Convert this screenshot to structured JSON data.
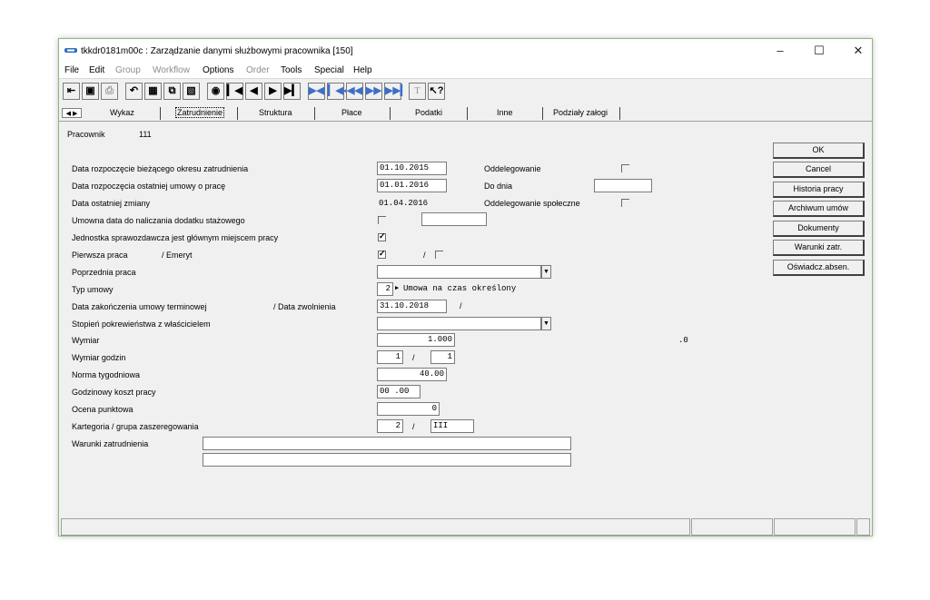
{
  "window": {
    "title": "tkkdr0181m00c : Zarządzanie danymi służbowymi pracownika [150]"
  },
  "menu": [
    {
      "label": "File",
      "enabled": true
    },
    {
      "label": "Edit",
      "enabled": true
    },
    {
      "label": "Group",
      "enabled": false
    },
    {
      "label": "Workflow",
      "enabled": false
    },
    {
      "label": "Options",
      "enabled": true
    },
    {
      "label": "Order",
      "enabled": false
    },
    {
      "label": "Tools",
      "enabled": true
    },
    {
      "label": "Special",
      "enabled": true
    },
    {
      "label": "Help",
      "enabled": true
    }
  ],
  "toolbar": {
    "icons": [
      "exit-icon",
      "save-icon",
      "print-icon",
      "undo-icon",
      "insert-record-icon",
      "copy-record-icon",
      "delete-record-icon",
      "find-icon",
      "first-record-icon",
      "previous-record-icon",
      "next-record-icon",
      "last-record-icon",
      "first-set-icon",
      "previous-set-icon",
      "previous-page-icon",
      "next-page-icon",
      "last-set-icon",
      "text-icon",
      "help-pointer-icon"
    ]
  },
  "tabs": [
    "Wykaz",
    "Zatrudnienie",
    "Struktura",
    "Płace",
    "Podatki",
    "Inne",
    "Podziały załogi"
  ],
  "active_tab": "Zatrudnienie",
  "employee": {
    "label": "Pracownik",
    "value": "111"
  },
  "form": {
    "data_rozpoczecia_okresu_label": "Data rozpoczęcie bieżącego okresu zatrudnienia",
    "data_rozpoczecia_okresu": "01.10.2015",
    "data_rozpoczecia_umowy_label": "Data rozpoczęcia ostatniej umowy o pracę",
    "data_rozpoczecia_umowy": "01.01.2016",
    "data_ostatniej_zmiany_label": "Data ostatniej zmiany",
    "data_ostatniej_zmiany": "01.04.2016",
    "umowna_data_label": "Umowna data do naliczania dodatku stażowego",
    "jednostka_label": "Jednostka sprawozdawcza jest głównym miejscem pracy",
    "pierwsza_praca_label": "Pierwsza praca",
    "emeryt_label": "/    Emeryt",
    "slash": "/",
    "poprzednia_praca_label": "Poprzednia praca",
    "typ_umowy_label": "Typ umowy",
    "typ_umowy_code": "2",
    "typ_umowy_desc": "Umowa na czas określony",
    "data_zakonczenia_label": "Data zakończenia umowy terminowej",
    "data_zwolnienia_label": "/ Data zwolnienia",
    "data_zakonczenia": "31.10.2018",
    "stopien_label": "Stopień pokrewieństwa z właścicielem",
    "wymiar_label": "Wymiar",
    "wymiar": "1.000",
    "wymiar_extra": ".0",
    "wymiar_godzin_label": "Wymiar godzin",
    "wymiar_godzin_a": "1",
    "wymiar_godzin_b": "1",
    "norma_label": "Norma tygodniowa",
    "norma": "40.00",
    "koszt_label": "Godzinowy koszt pracy",
    "koszt": "00 .00",
    "ocena_label": "Ocena punktowa",
    "ocena": "0",
    "kategoria_label": "Kartegoria / grupa zaszeregowania",
    "kategoria": "2",
    "grupa": "III",
    "warunki_label": "Warunki zatrudnienia",
    "oddelegowanie_label": "Oddelegowanie",
    "do_dnia_label": "Do dnia",
    "oddelegowanie_spoleczne_label": "Oddelegowanie społeczne"
  },
  "checkboxes": {
    "oddelegowanie": false,
    "oddelegowanie_spoleczne": false,
    "umowna_data": false,
    "jednostka": true,
    "pierwsza_praca": true,
    "emeryt": false
  },
  "buttons": {
    "ok": "OK",
    "cancel": "Cancel",
    "historia": "Historia pracy",
    "archiwum": "Archiwum umów",
    "dokumenty": "Dokumenty",
    "warunki": "Warunki zatr.",
    "oswiadcz": "Oświadcz.absen."
  }
}
